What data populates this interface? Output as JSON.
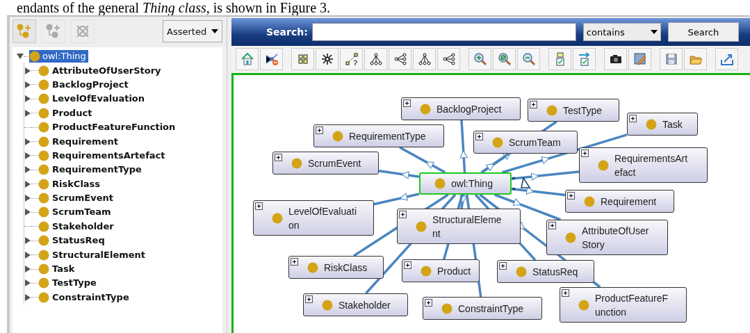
{
  "caption": "endants of the general *Thing class*, is shown in Figure 3.",
  "tree_tools": [
    {
      "disabled": false
    },
    {
      "disabled": true
    },
    {
      "disabled": true
    }
  ],
  "hierarchy_mode": "Asserted",
  "tree": {
    "label": "owl:Thing",
    "selected": true,
    "expanded": true,
    "children": [
      {
        "label": "AttributeOfUserStory",
        "expandable": true
      },
      {
        "label": "BacklogProject",
        "expandable": true
      },
      {
        "label": "LevelOfEvaluation",
        "expandable": true
      },
      {
        "label": "Product",
        "expandable": true
      },
      {
        "label": "ProductFeatureFunction",
        "expandable": false
      },
      {
        "label": "Requirement",
        "expandable": true
      },
      {
        "label": "RequirementsArtefact",
        "expandable": true
      },
      {
        "label": "RequirementType",
        "expandable": true
      },
      {
        "label": "RiskClass",
        "expandable": true
      },
      {
        "label": "ScrumEvent",
        "expandable": true
      },
      {
        "label": "ScrumTeam",
        "expandable": true
      },
      {
        "label": "Stakeholder",
        "expandable": false
      },
      {
        "label": "StatusReq",
        "expandable": true
      },
      {
        "label": "StructuralElement",
        "expandable": true
      },
      {
        "label": "Task",
        "expandable": true
      },
      {
        "label": "TestType",
        "expandable": true
      },
      {
        "label": "ConstraintType",
        "expandable": true
      }
    ]
  },
  "search": {
    "label": "Search:",
    "mode": "contains",
    "button": "Search"
  },
  "graph_nodes": [
    {
      "label": "BacklogProject",
      "kind": "class"
    },
    {
      "label": "TestType",
      "kind": "class"
    },
    {
      "label": "Task",
      "kind": "class"
    },
    {
      "label": "RequirementType",
      "kind": "class"
    },
    {
      "label": "ScrumTeam",
      "kind": "class"
    },
    {
      "label": "ScrumEvent",
      "kind": "class"
    },
    {
      "label": "RequirementsArt\nefact",
      "kind": "class"
    },
    {
      "label": "owl:Thing",
      "kind": "focus"
    },
    {
      "label": "Requirement",
      "kind": "class"
    },
    {
      "label": "LevelOfEvaluati\non",
      "kind": "class"
    },
    {
      "label": "StructuralEleme\nnt",
      "kind": "class"
    },
    {
      "label": "AttributeOfUser\nStory",
      "kind": "class"
    },
    {
      "label": "RiskClass",
      "kind": "class"
    },
    {
      "label": "Product",
      "kind": "class"
    },
    {
      "label": "StatusReq",
      "kind": "class"
    },
    {
      "label": "Stakeholder",
      "kind": "class"
    },
    {
      "label": "ConstraintType",
      "kind": "class"
    },
    {
      "label": "ProductFeatureF\nunction",
      "kind": "class"
    }
  ]
}
